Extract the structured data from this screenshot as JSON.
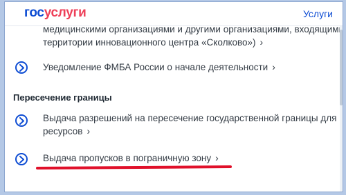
{
  "header": {
    "logo_gos": "гос",
    "logo_uslugi": "услуги",
    "services_link": "Услуги"
  },
  "items": [
    {
      "line1": "медицинскими организациями и другими организациями, входящими в ча",
      "line2": "территории инновационного центра «Сколково»)"
    },
    {
      "line1": "Уведомление ФМБА России о начале деятельности"
    },
    {
      "line1": "Выдача разрешений на пересечение государственной границы для переп",
      "line2": "ресурсов"
    },
    {
      "line1": "Выдача пропусков в пограничную зону"
    }
  ],
  "section_title": "Пересечение границы",
  "icons": {
    "link_icon": "chevron-circle-right-icon",
    "arrow": "chevron-right-icon"
  },
  "colors": {
    "brand_blue": "#0d4cd3",
    "brand_red": "#ee3f58",
    "annotation_red": "#e0102a",
    "text": "#333b44"
  }
}
